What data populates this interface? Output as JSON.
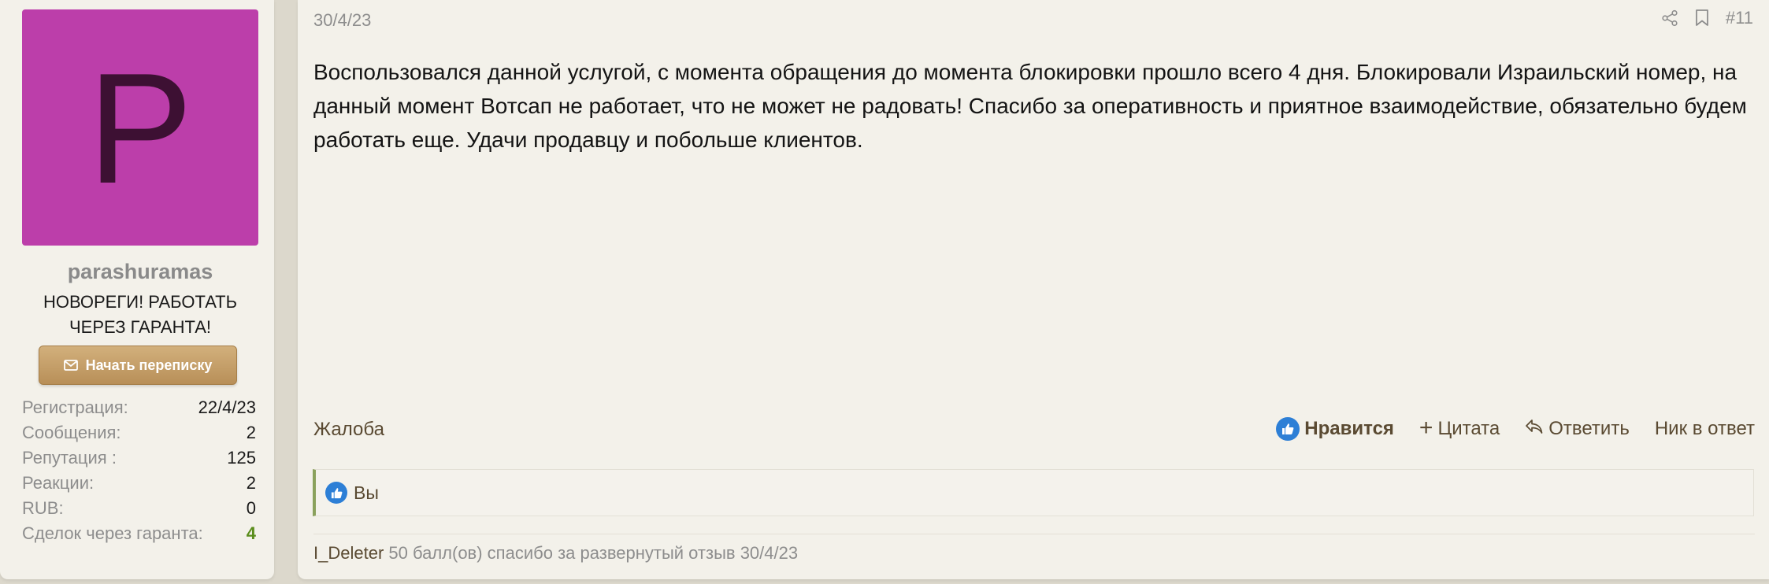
{
  "user": {
    "avatar_letter": "P",
    "avatar_color": "#bc3eaa",
    "username": "parashuramas",
    "title": "НОВОРЕГИ! РАБОТАТЬ ЧЕРЕЗ ГАРАНТА!",
    "pm_button": {
      "label": "Начать переписку",
      "icon": "envelope-icon"
    },
    "stats": [
      {
        "label": "Регистрация:",
        "value": "22/4/23"
      },
      {
        "label": "Сообщения:",
        "value": "2"
      },
      {
        "label": "Репутация :",
        "value": "125"
      },
      {
        "label": "Реакции:",
        "value": "2"
      },
      {
        "label": "RUB:",
        "value": "0"
      },
      {
        "label": "Сделок через гаранта:",
        "value": "4"
      }
    ]
  },
  "post": {
    "date": "30/4/23",
    "number": "#11",
    "tools": [
      "share-icon",
      "bookmark-icon"
    ],
    "body": "Воспользовался данной услугой, с момента обращения до момента блокировки прошло всего 4 дня. Блокировали Израильский номер, на данный момент Вотсап не работает, что не может не радовать! Спасибо за оперативность и приятное взаимодействие, обязательно будем работать еще. Удачи продавцу и побольше клиентов.",
    "actions": {
      "report": "Жалоба",
      "like": "Нравится",
      "quote": "Цитата",
      "reply": "Ответить",
      "mention": "Ник в ответ"
    },
    "reactions": {
      "icon": "thumbs-up-icon",
      "text": "Вы"
    },
    "rating": {
      "user": "I_Deleter",
      "text": "50 балл(ов) спасибо за развернутый отзыв 30/4/23"
    }
  },
  "colors": {
    "accent_brown": "#5a4a32",
    "button_gold": "#c6a06a",
    "like_blue": "#2d7fd6",
    "deal_green": "#5a8d1c",
    "reaction_border": "#8aa15c"
  }
}
